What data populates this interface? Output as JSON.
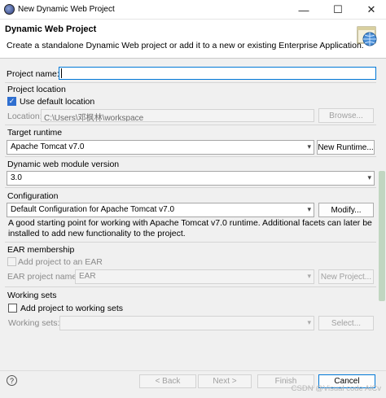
{
  "window": {
    "title": "New Dynamic Web Project",
    "minimize": "—",
    "maximize": "☐",
    "close": "✕"
  },
  "header": {
    "title": "Dynamic Web Project",
    "description": "Create a standalone Dynamic Web project or add it to a new or existing Enterprise Application."
  },
  "project_name": {
    "label": "Project name:",
    "value": ""
  },
  "project_location": {
    "group_label": "Project location",
    "use_default_label": "Use default location",
    "use_default_checked": true,
    "location_label": "Location:",
    "location_value": "C:\\Users\\邓枫林\\workspace",
    "browse_label": "Browse..."
  },
  "target_runtime": {
    "group_label": "Target runtime",
    "selected": "Apache Tomcat v7.0",
    "new_runtime_label": "New Runtime..."
  },
  "module_version": {
    "group_label": "Dynamic web module version",
    "selected": "3.0"
  },
  "configuration": {
    "group_label": "Configuration",
    "selected": "Default Configuration for Apache Tomcat v7.0",
    "modify_label": "Modify...",
    "description": "A good starting point for working with Apache Tomcat v7.0 runtime. Additional facets can later be installed to add new functionality to the project."
  },
  "ear": {
    "group_label": "EAR membership",
    "add_label": "Add project to an EAR",
    "project_name_label": "EAR project name:",
    "project_name_value": "EAR",
    "new_project_label": "New Project..."
  },
  "working_sets": {
    "group_label": "Working sets",
    "add_label": "Add project to working sets",
    "sets_label": "Working sets:",
    "select_label": "Select..."
  },
  "footer": {
    "help": "?",
    "back": "< Back",
    "next": "Next >",
    "finish": "Finish",
    "cancel": "Cancel"
  },
  "watermark": "CSDN @Visual code AlCv",
  "icons": {
    "dropdown": "▾",
    "check": "✓"
  }
}
